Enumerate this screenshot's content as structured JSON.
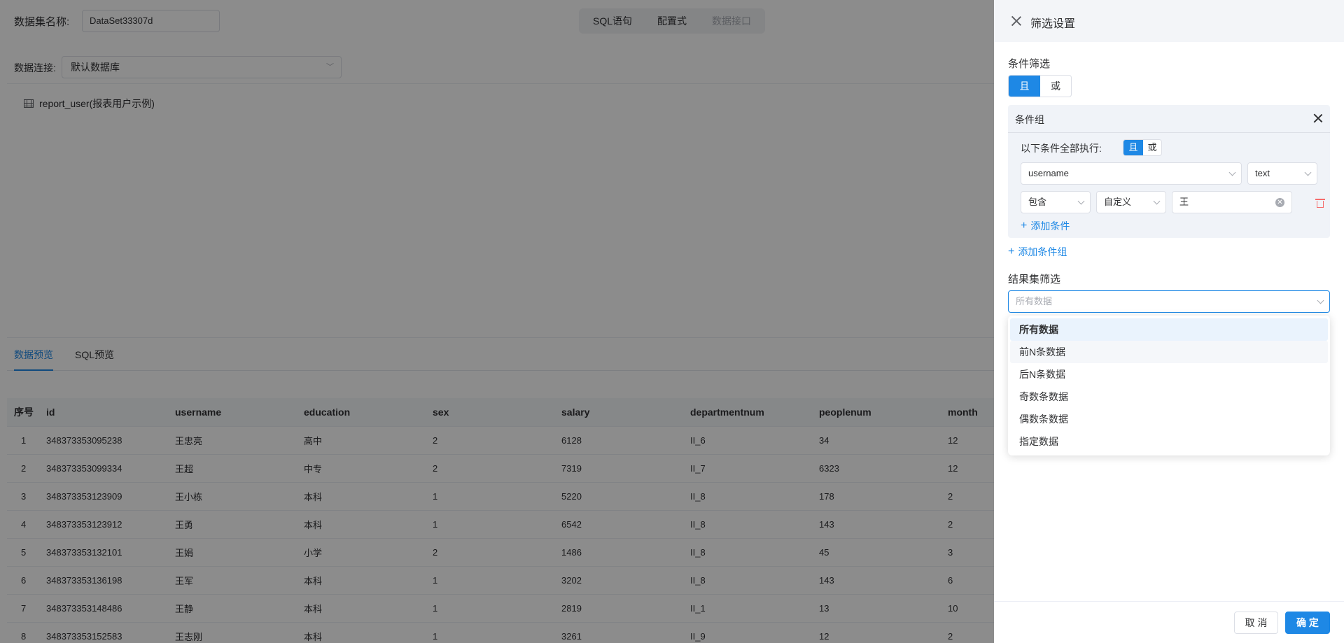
{
  "header": {
    "dataset_label": "数据集名称:",
    "dataset_name": "DataSet33307d",
    "modes": [
      "SQL语句",
      "配置式",
      "数据接口"
    ]
  },
  "connection": {
    "label": "数据连接:",
    "value": "默认数据库"
  },
  "tree": {
    "table_name": "report_user(报表用户示例)"
  },
  "preview": {
    "tabs": [
      "数据预览",
      "SQL预览"
    ],
    "active_tab": "数据预览"
  },
  "table": {
    "columns": [
      "序号",
      "id",
      "username",
      "education",
      "sex",
      "salary",
      "departmentnum",
      "peoplenum",
      "month"
    ],
    "rows": [
      [
        "1",
        "348373353095238",
        "王忠亮",
        "高中",
        "2",
        "6128",
        "II_6",
        "34",
        "12"
      ],
      [
        "2",
        "348373353099334",
        "王超",
        "中专",
        "2",
        "7319",
        "II_7",
        "6323",
        "12"
      ],
      [
        "3",
        "348373353123909",
        "王小栋",
        "本科",
        "1",
        "5220",
        "II_8",
        "178",
        "2"
      ],
      [
        "4",
        "348373353123912",
        "王勇",
        "本科",
        "1",
        "6542",
        "II_8",
        "143",
        "2"
      ],
      [
        "5",
        "348373353132101",
        "王娟",
        "小学",
        "2",
        "1486",
        "II_8",
        "45",
        "3"
      ],
      [
        "6",
        "348373353136198",
        "王军",
        "本科",
        "1",
        "3202",
        "II_8",
        "143",
        "6"
      ],
      [
        "7",
        "348373353148486",
        "王静",
        "本科",
        "1",
        "2819",
        "II_1",
        "13",
        "10"
      ],
      [
        "8",
        "348373353152583",
        "王志刚",
        "本科",
        "1",
        "3261",
        "II_9",
        "12",
        "2"
      ]
    ]
  },
  "drawer": {
    "title": "筛选设置",
    "condition_filter_label": "条件筛选",
    "logic_options": [
      "且",
      "或"
    ],
    "group": {
      "title": "条件组",
      "exec_label": "以下条件全部执行:",
      "logic_options": [
        "且",
        "或"
      ],
      "field": "username",
      "field_type": "text",
      "operator": "包含",
      "value_mode": "自定义",
      "value": "王",
      "add_condition": "添加条件"
    },
    "add_group": "添加条件组",
    "result_filter_label": "结果集筛选",
    "result_placeholder": "所有数据",
    "result_options": [
      "所有数据",
      "前N条数据",
      "后N条数据",
      "奇数条数据",
      "偶数条数据",
      "指定数据"
    ],
    "cancel": "取 消",
    "confirm": "确 定"
  },
  "colors": {
    "accent": "#1e88e5",
    "danger": "#f56c6c",
    "mask": "rgba(0,0,0,0.45)"
  }
}
